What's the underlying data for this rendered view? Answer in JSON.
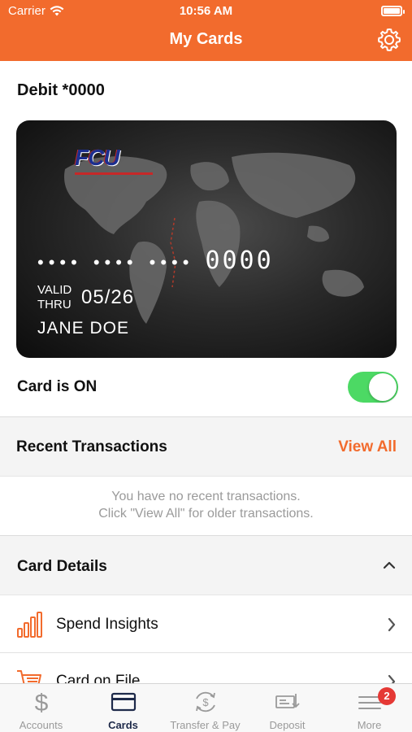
{
  "status_bar": {
    "carrier": "Carrier",
    "time": "10:56 AM"
  },
  "nav": {
    "title": "My Cards"
  },
  "card_section": {
    "title": "Debit *0000",
    "card": {
      "logo_text": "FCU",
      "masked_groups": [
        "••••",
        "••••",
        "••••"
      ],
      "last4": "0000",
      "valid_thru_label_1": "VALID",
      "valid_thru_label_2": "THRU",
      "expiry": "05/26",
      "holder_name": "JANE DOE"
    },
    "card_status_label": "Card is ON",
    "card_status_on": true
  },
  "recent_transactions": {
    "title": "Recent Transactions",
    "view_all_label": "View All",
    "empty_line_1": "You have no recent transactions.",
    "empty_line_2": "Click \"View All\" for older transactions."
  },
  "card_details": {
    "title": "Card Details",
    "items": [
      {
        "label": "Spend Insights",
        "icon": "bar-chart-icon"
      },
      {
        "label": "Card on File",
        "icon": "shopping-cart-icon"
      }
    ]
  },
  "tabbar": {
    "tabs": [
      {
        "label": "Accounts",
        "icon": "dollar-icon",
        "active": false
      },
      {
        "label": "Cards",
        "icon": "credit-card-icon",
        "active": true
      },
      {
        "label": "Transfer & Pay",
        "icon": "transfer-icon",
        "active": false
      },
      {
        "label": "Deposit",
        "icon": "check-deposit-icon",
        "active": false
      },
      {
        "label": "More",
        "icon": "menu-icon",
        "active": false
      }
    ],
    "more_badge": "2"
  },
  "colors": {
    "brand_orange": "#f26b2d",
    "toggle_green": "#4cd964",
    "badge_red": "#e53935",
    "active_tab": "#1e2a4a"
  }
}
